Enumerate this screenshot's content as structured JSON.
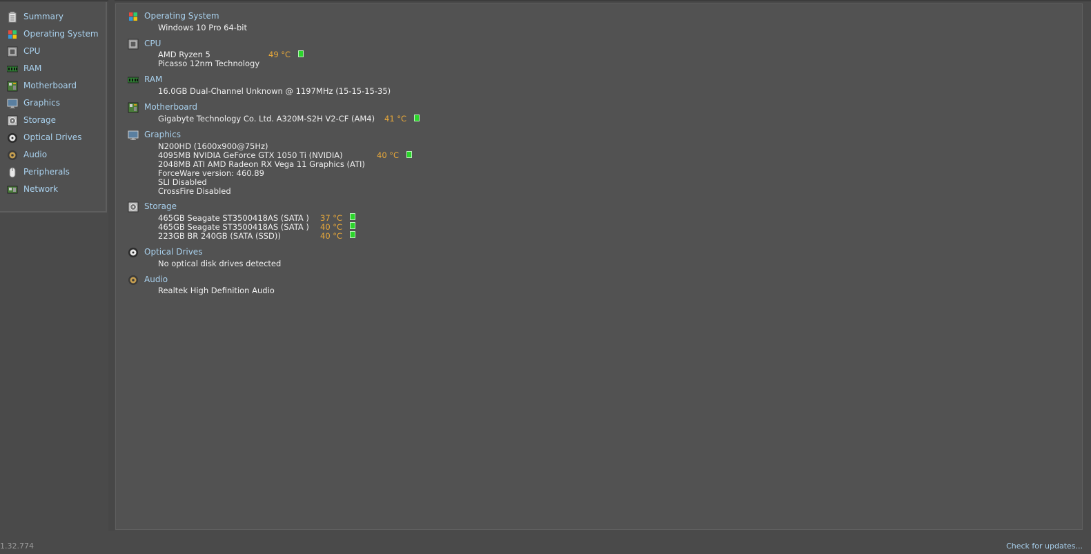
{
  "sidebar": {
    "items": [
      {
        "label": "Summary",
        "icon": "summary-icon"
      },
      {
        "label": "Operating System",
        "icon": "windows-icon"
      },
      {
        "label": "CPU",
        "icon": "cpu-icon"
      },
      {
        "label": "RAM",
        "icon": "ram-icon"
      },
      {
        "label": "Motherboard",
        "icon": "motherboard-icon"
      },
      {
        "label": "Graphics",
        "icon": "monitor-icon"
      },
      {
        "label": "Storage",
        "icon": "hdd-icon"
      },
      {
        "label": "Optical Drives",
        "icon": "disc-icon"
      },
      {
        "label": "Audio",
        "icon": "speaker-icon"
      },
      {
        "label": "Peripherals",
        "icon": "mouse-icon"
      },
      {
        "label": "Network",
        "icon": "network-icon"
      }
    ]
  },
  "sections": {
    "os": {
      "title": "Operating System",
      "lines": [
        "Windows 10 Pro 64-bit"
      ]
    },
    "cpu": {
      "title": "CPU",
      "lines": [
        "AMD Ryzen 5",
        "Picasso 12nm Technology"
      ],
      "temp": "49 °C"
    },
    "ram": {
      "title": "RAM",
      "lines": [
        "16.0GB Dual-Channel Unknown @ 1197MHz (15-15-15-35)"
      ]
    },
    "motherboard": {
      "title": "Motherboard",
      "lines": [
        "Gigabyte Technology Co. Ltd. A320M-S2H V2-CF (AM4)"
      ],
      "temp": "41 °C"
    },
    "graphics": {
      "title": "Graphics",
      "lines": [
        "N200HD (1600x900@75Hz)",
        "4095MB NVIDIA GeForce GTX 1050 Ti (NVIDIA)",
        "2048MB ATI AMD Radeon RX Vega 11 Graphics (ATI)",
        "ForceWare version: 460.89",
        "SLI Disabled",
        "CrossFire Disabled"
      ],
      "temp": "40 °C"
    },
    "storage": {
      "title": "Storage",
      "lines": [
        "465GB Seagate ST3500418AS (SATA )",
        "465GB Seagate ST3500418AS (SATA )",
        "223GB BR 240GB (SATA (SSD))"
      ],
      "temps": [
        "37 °C",
        "40 °C",
        "40 °C"
      ]
    },
    "optical": {
      "title": "Optical Drives",
      "lines": [
        "No optical disk drives detected"
      ]
    },
    "audio": {
      "title": "Audio",
      "lines": [
        "Realtek High Definition Audio"
      ]
    }
  },
  "footer": {
    "version": "1.32.774",
    "update_link": "Check for updates..."
  },
  "colors": {
    "link": "#a9d1ee",
    "temp": "#e9a93a",
    "temp_ok": "#2bd62b",
    "background": "#4a4a4a"
  }
}
